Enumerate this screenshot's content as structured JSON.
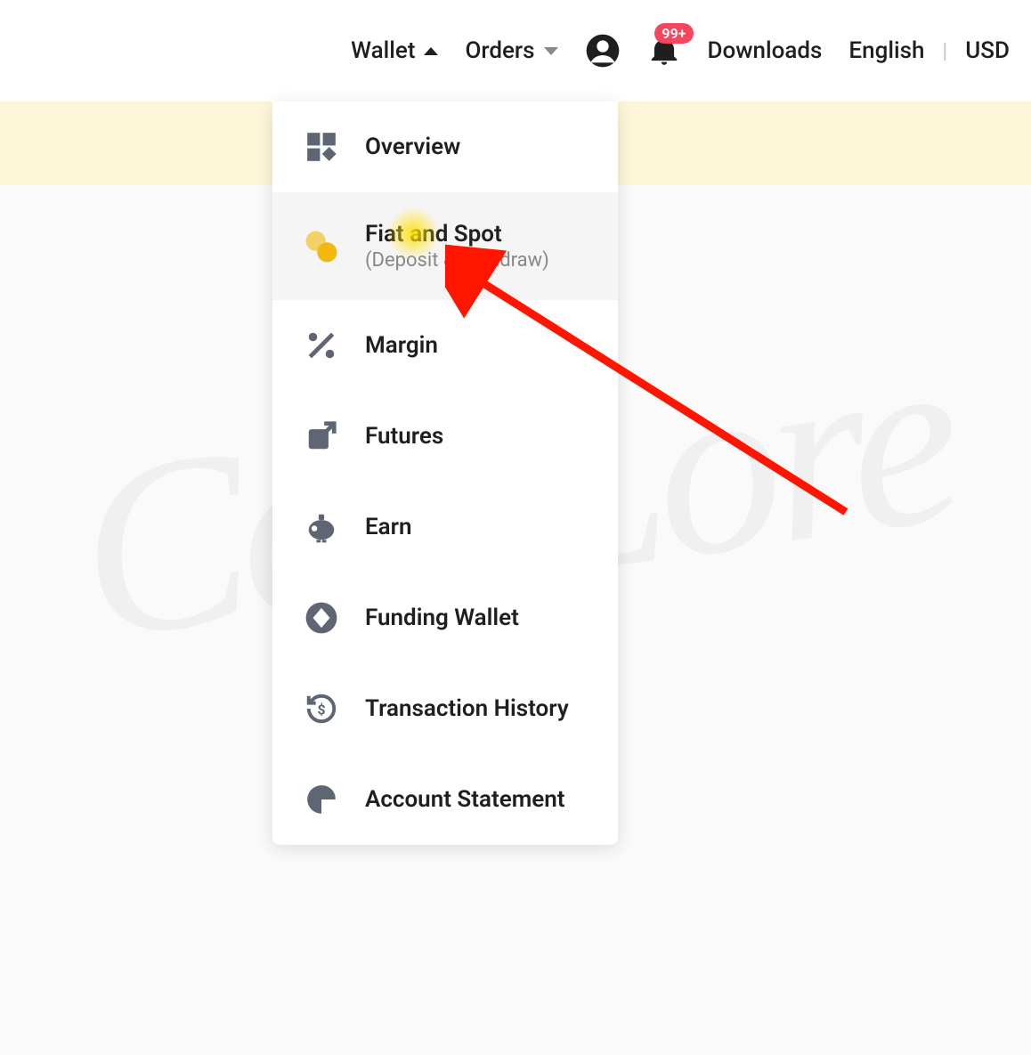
{
  "nav": {
    "wallet": "Wallet",
    "orders": "Orders",
    "downloads": "Downloads",
    "language": "English",
    "currency": "USD",
    "badge": "99+"
  },
  "dropdown": {
    "items": [
      {
        "label": "Overview"
      },
      {
        "label": "Fiat and Spot",
        "sub": "(Deposit & Withdraw)"
      },
      {
        "label": "Margin"
      },
      {
        "label": "Futures"
      },
      {
        "label": "Earn"
      },
      {
        "label": "Funding Wallet"
      },
      {
        "label": "Transaction History"
      },
      {
        "label": "Account Statement"
      }
    ]
  },
  "watermark": "CoinLore"
}
